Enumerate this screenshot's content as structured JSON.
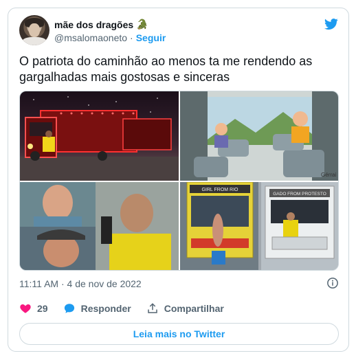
{
  "author": {
    "display_name": "mãe dos dragões",
    "emoji": "🐊",
    "handle": "@msalomaoneto",
    "separator": "·",
    "follow_label": "Seguir"
  },
  "tweet": {
    "text": "O patriota do caminhão ao menos ta me rendendo as gargalhadas mais gostosas e sinceras",
    "timestamp": "11:11 AM · 4 de nov de 2022"
  },
  "media": {
    "tile2_signature": "Gérrai",
    "tile4_left_sign": "GIRL FROM RIO",
    "tile4_right_sign": "GADO FROM PROTESTO"
  },
  "actions": {
    "like_count": "29",
    "reply_label": "Responder",
    "share_label": "Compartilhar"
  },
  "read_more_label": "Leia mais no Twitter",
  "colors": {
    "brand": "#1d9bf0",
    "like": "#f91880",
    "text": "#0f1419",
    "muted": "#536471",
    "border": "#cfd9de"
  },
  "icons": [
    "twitter-bird-icon",
    "heart-icon",
    "reply-bubble-icon",
    "share-icon",
    "info-icon"
  ]
}
